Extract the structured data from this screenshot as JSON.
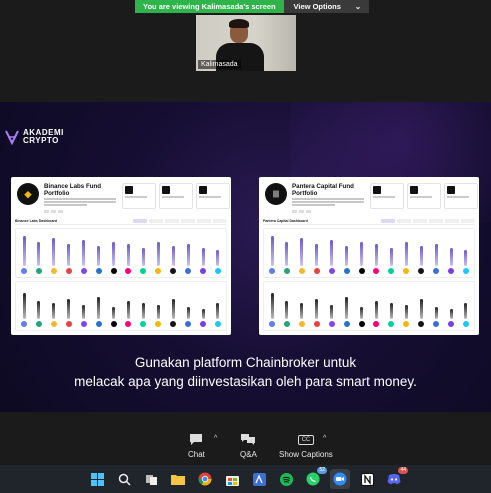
{
  "share_banner": {
    "viewing_text": "You are viewing Kalimasada's screen",
    "view_options_label": "View Options",
    "view_options_caret": "⌄"
  },
  "participant": {
    "name": "Kalimasada"
  },
  "slide": {
    "logo_line1": "AKADEMI",
    "logo_line2": "CRYPTO",
    "caption_line1": "Gunakan platform Chainbroker untuk",
    "caption_line2": "melacak apa yang diinvestasikan oleh para smart money.",
    "cards": [
      {
        "title": "Binance Labs Fund Portfolio",
        "section": "Binance Labs Dashboard",
        "avatar_glyph": "◆"
      },
      {
        "title": "Pantera Capital Fund Portfolio",
        "section": "Pantera Capital Dashboard",
        "avatar_glyph": "|||"
      }
    ]
  },
  "controls": {
    "chat_label": "Chat",
    "qa_label": "Q&A",
    "captions_label": "Show Captions",
    "captions_icon_text": "CC",
    "caret": "^"
  },
  "taskbar": {
    "whatsapp_badge": "52",
    "discord_badge": "44",
    "icons": [
      "windows-start",
      "search",
      "task-view",
      "file-explorer",
      "chrome",
      "microsoft-store",
      "vscode",
      "spotify",
      "whatsapp",
      "zoom",
      "notion",
      "discord"
    ]
  }
}
